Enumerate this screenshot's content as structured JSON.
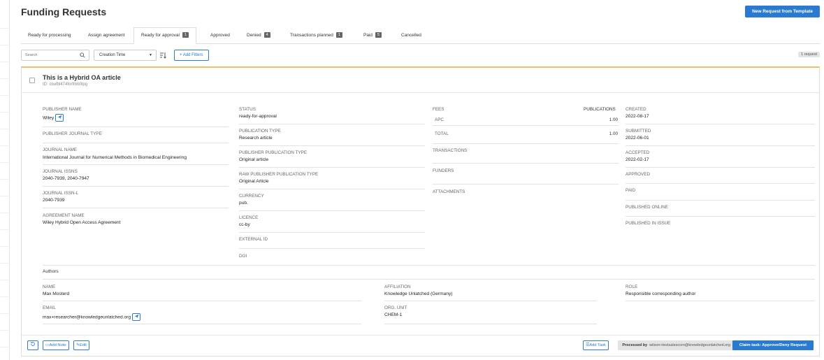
{
  "page": {
    "title": "Funding Requests",
    "new_request_label": "New Request from Template"
  },
  "tabs": [
    {
      "label": "Ready for processing",
      "badge": null
    },
    {
      "label": "Assign agreement",
      "badge": null
    },
    {
      "label": "Ready for approval",
      "badge": "1"
    },
    {
      "label": "Approved",
      "badge": null
    },
    {
      "label": "Denied",
      "badge": "4"
    },
    {
      "label": "Transactions planned",
      "badge": "1"
    },
    {
      "label": "Paid",
      "badge": "5"
    },
    {
      "label": "Cancelled",
      "badge": null
    }
  ],
  "filters": {
    "search_placeholder": "Search",
    "sort_value": "Creation Time",
    "add_filters_label": "+ Add Filters",
    "count_label": "1 request"
  },
  "request": {
    "title": "This is a Hybrid OA article",
    "id_text": "ID: cbufbl474forfrbb0lpg",
    "col1": {
      "publisher_name_label": "PUBLISHER NAME",
      "publisher_name": "Wiley",
      "publisher_journal_type_label": "PUBLISHER JOURNAL TYPE",
      "journal_name_label": "JOURNAL NAME",
      "journal_name": "International Journal for Numerical Methods in Biomedical Engineering",
      "journal_issns_label": "JOURNAL ISSNS",
      "journal_issns": "2040-7939, 2040-7947",
      "journal_issnl_label": "JOURNAL ISSN-L",
      "journal_issnl": "2040-7939",
      "agreement_name_label": "AGREEMENT NAME",
      "agreement_name": "Wiley Hybrid Open Access Agreement"
    },
    "col2": {
      "status_label": "STATUS",
      "status": "ready-for-approval",
      "publication_type_label": "PUBLICATION TYPE",
      "publication_type": "Research article",
      "publisher_publication_type_label": "PUBLISHER PUBLICATION TYPE",
      "publisher_publication_type": "Original article",
      "raw_publisher_publication_type_label": "RAW PUBLISHER PUBLICATION TYPE",
      "raw_publisher_publication_type": "Original Article",
      "currency_label": "CURRENCY",
      "currency": "pub.",
      "licence_label": "LICENCE",
      "licence": "cc-by",
      "external_id_label": "EXTERNAL ID",
      "doi_label": "DOI"
    },
    "col3": {
      "fees_label": "FEES",
      "publications_label": "PUBLICATIONS",
      "apc_label": "APC",
      "apc_value": "1.00",
      "total_label": "TOTAL",
      "total_value": "1.00",
      "transactions_label": "TRANSACTIONS",
      "funders_label": "FUNDERS",
      "attachments_label": "ATTACHMENTS"
    },
    "col4": {
      "created_label": "CREATED",
      "created": "2022-08-17",
      "submitted_label": "SUBMITTED",
      "submitted": "2022-06-01",
      "accepted_label": "ACCEPTED",
      "accepted": "2022-02-17",
      "approved_label": "APPROVED",
      "paid_label": "PAID",
      "published_online_label": "PUBLISHED ONLINE",
      "published_in_issue_label": "PUBLISHED IN ISSUE"
    },
    "authors": {
      "heading": "Authors",
      "name_label": "NAME",
      "name": "Max Mosterd",
      "affiliation_label": "AFFILIATION",
      "affiliation": "Knowledge Unlatched (Germany)",
      "role_label": "ROLE",
      "role": "Responsible corresponding author",
      "email_label": "EMAIL",
      "email": "max+researcher@knowledgeunlatched.org",
      "org_unit_label": "ORG. UNIT",
      "org_unit": "CHEM-1"
    }
  },
  "footer": {
    "add_note_label": "Add Note",
    "edit_label": "Edit",
    "add_task_label": "Add Task",
    "processed_by_label": "Processed by",
    "processed_by": "wilson+testsalescom@knowledgeunlatched.org",
    "claim_label": "Claim task: Approve/Deny Request"
  },
  "colors": {
    "accent": "#2a7bd0",
    "highlight_border": "#f0c060",
    "badge": "#666666"
  }
}
